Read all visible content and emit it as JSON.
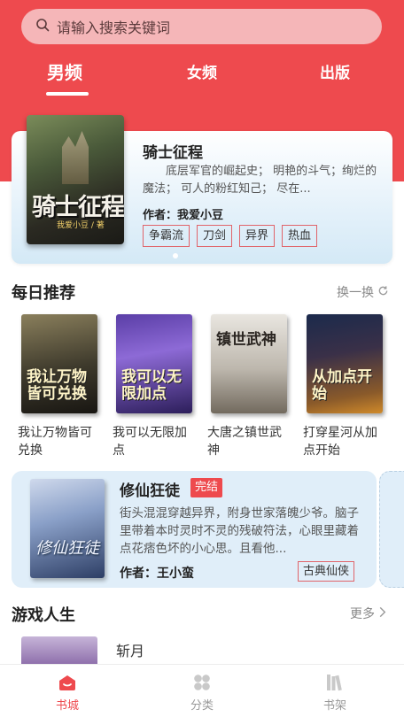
{
  "search": {
    "placeholder": "请输入搜索关键词"
  },
  "tabs": [
    {
      "label": "男频",
      "active": true
    },
    {
      "label": "女频",
      "active": false
    },
    {
      "label": "出版",
      "active": false
    }
  ],
  "featured": {
    "title": "骑士征程",
    "description": "底层军官的崛起史； 明艳的斗气；绚烂的魔法； 可人的粉红知己； 尽在...",
    "author": "作者：我爱小豆",
    "tags": [
      "争霸流",
      "刀剑",
      "异界",
      "热血"
    ],
    "cover_text": "骑士征程",
    "cover_subtext": "我爱小豆 / 著"
  },
  "daily": {
    "title": "每日推荐",
    "action_label": "换一换",
    "books": [
      {
        "name": "我让万物皆可兑换",
        "cover_text": "我让万物皆可兑换"
      },
      {
        "name": "我可以无限加点",
        "cover_text": "我可以无限加点"
      },
      {
        "name": "大唐之镇世武神",
        "cover_text": "镇世武神"
      },
      {
        "name": "打穿星河从加点开始",
        "cover_text": "从加点开始"
      }
    ]
  },
  "complete": {
    "title": "修仙狂徒",
    "badge": "完结",
    "description": "街头混混穿越异界，附身世家落魄少爷。脑子里带着本时灵时不灵的残破符法，心眼里藏着点花痞色坏的小心思。且看他...",
    "author": "作者：王小蛮",
    "tag": "古典仙侠",
    "cover_text": "修仙狂徒"
  },
  "game": {
    "title": "游戏人生",
    "more_label": "更多",
    "books": [
      {
        "name": "斩月"
      }
    ]
  },
  "nav": [
    {
      "label": "书城",
      "icon": "bookstore-icon",
      "active": true
    },
    {
      "label": "分类",
      "icon": "category-icon",
      "active": false
    },
    {
      "label": "书架",
      "icon": "bookshelf-icon",
      "active": false
    }
  ],
  "colors": {
    "accent": "#ee4a4e",
    "card_bg": "#e0eef9"
  }
}
